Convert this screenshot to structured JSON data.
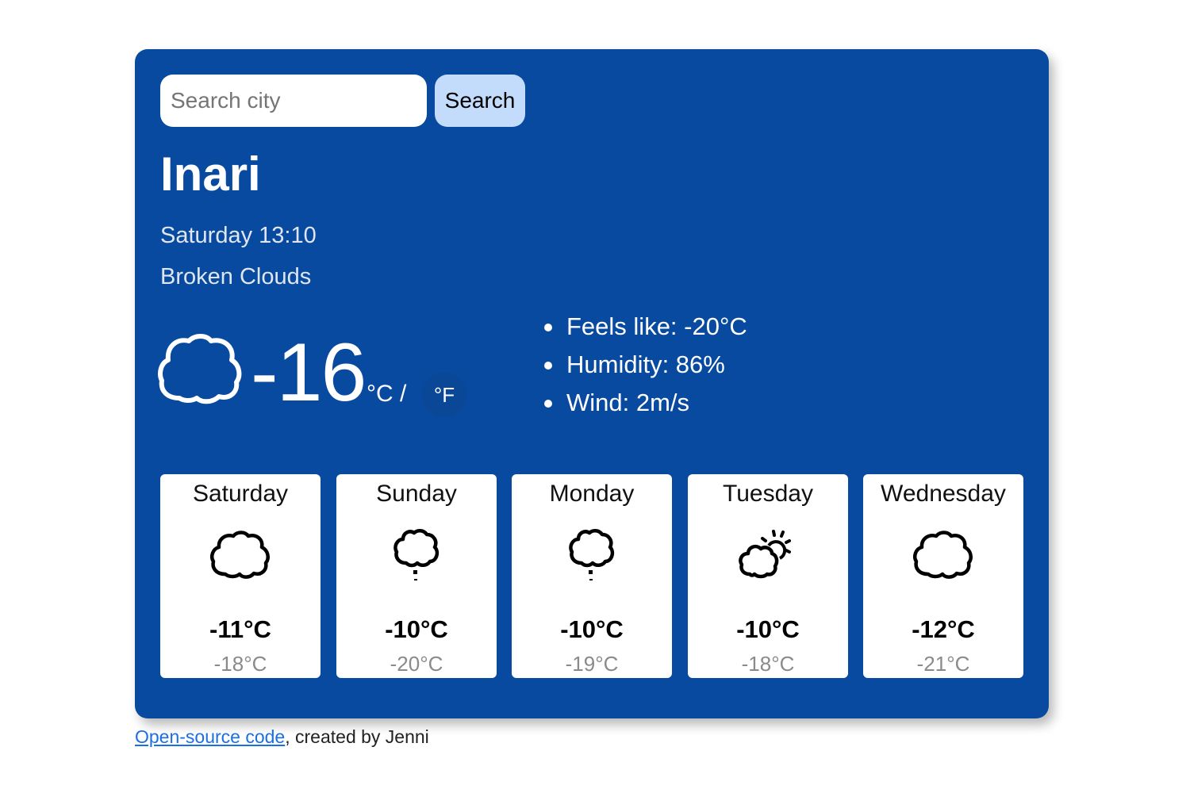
{
  "search": {
    "placeholder": "Search city",
    "value": "",
    "button_label": "Search"
  },
  "current": {
    "city": "Inari",
    "datetime": "Saturday 13:10",
    "description": "Broken Clouds",
    "icon": "broken-clouds-icon",
    "temperature": "-16",
    "unit_celsius": "°C /",
    "unit_fahrenheit": "°F",
    "details": [
      {
        "label": "Feels like: -20°C"
      },
      {
        "label": "Humidity: 86%"
      },
      {
        "label": "Wind: 2m/s"
      }
    ]
  },
  "forecast": [
    {
      "day": "Saturday",
      "icon": "cloud-icon",
      "max": "-11°C",
      "min": "-18°C"
    },
    {
      "day": "Sunday",
      "icon": "cloud-snow-icon",
      "max": "-10°C",
      "min": "-20°C"
    },
    {
      "day": "Monday",
      "icon": "cloud-snow-icon",
      "max": "-10°C",
      "min": "-19°C"
    },
    {
      "day": "Tuesday",
      "icon": "partly-cloudy-icon",
      "max": "-10°C",
      "min": "-18°C"
    },
    {
      "day": "Wednesday",
      "icon": "cloud-icon",
      "max": "-12°C",
      "min": "-21°C"
    }
  ],
  "footer": {
    "link_text": "Open-source code",
    "suffix": ", created by Jenni"
  },
  "colors": {
    "card_background": "#074a9f",
    "search_button": "#c3dcfc",
    "link": "#1a6ee6",
    "min_temp": "#8a8a8a"
  }
}
